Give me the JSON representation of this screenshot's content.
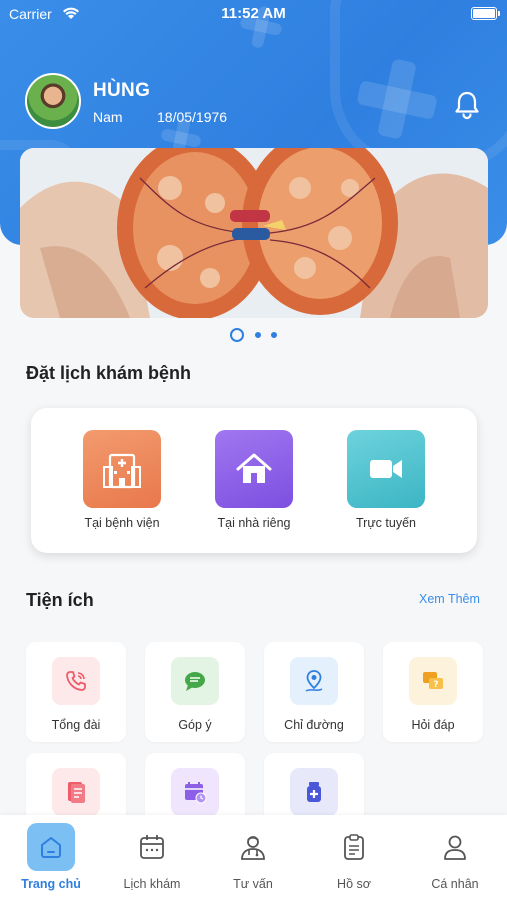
{
  "status_bar": {
    "carrier": "Carrier",
    "time": "11:52 AM"
  },
  "profile": {
    "name": "HÙNG",
    "gender": "Nam",
    "dob": "18/05/1976"
  },
  "banner": {
    "slides_total": 3,
    "active_slide": 1
  },
  "booking": {
    "title": "Đặt lịch khám bệnh",
    "items": [
      {
        "label": "Tại bệnh viện",
        "icon": "hospital-icon",
        "color": "#ef8a5d"
      },
      {
        "label": "Tại nhà riêng",
        "icon": "home-icon",
        "color": "#8c5fe6"
      },
      {
        "label": "Trực tuyến",
        "icon": "video-camera-icon",
        "color": "#4cc3cf"
      }
    ]
  },
  "utilities": {
    "title": "Tiện ích",
    "see_more": "Xem Thêm",
    "items": [
      {
        "label": "Tổng đài",
        "icon": "phone-icon",
        "color": "#ef5b6b"
      },
      {
        "label": "Góp ý",
        "icon": "chat-icon",
        "color": "#44a84a"
      },
      {
        "label": "Chỉ đường",
        "icon": "location-pin-icon",
        "color": "#2f7fe0"
      },
      {
        "label": "Hỏi đáp",
        "icon": "question-chat-icon",
        "color": "#f0a020"
      },
      {
        "label": "",
        "icon": "document-icon",
        "color": "#ef5b6b"
      },
      {
        "label": "",
        "icon": "calendar-clock-icon",
        "color": "#8c5fe6"
      },
      {
        "label": "",
        "icon": "medicine-bottle-icon",
        "color": "#4a57d8"
      }
    ]
  },
  "tabbar": {
    "items": [
      {
        "label": "Trang chủ",
        "icon": "home-tab-icon",
        "active": true
      },
      {
        "label": "Lịch khám",
        "icon": "calendar-icon",
        "active": false
      },
      {
        "label": "Tư vấn",
        "icon": "doctor-icon",
        "active": false
      },
      {
        "label": "Hồ sơ",
        "icon": "clipboard-icon",
        "active": false
      },
      {
        "label": "Cá nhân",
        "icon": "user-icon",
        "active": false
      }
    ]
  },
  "colors": {
    "primary": "#2f7fe0",
    "header_bg": "#3a8ee8",
    "page_bg": "#f6f7f9"
  }
}
